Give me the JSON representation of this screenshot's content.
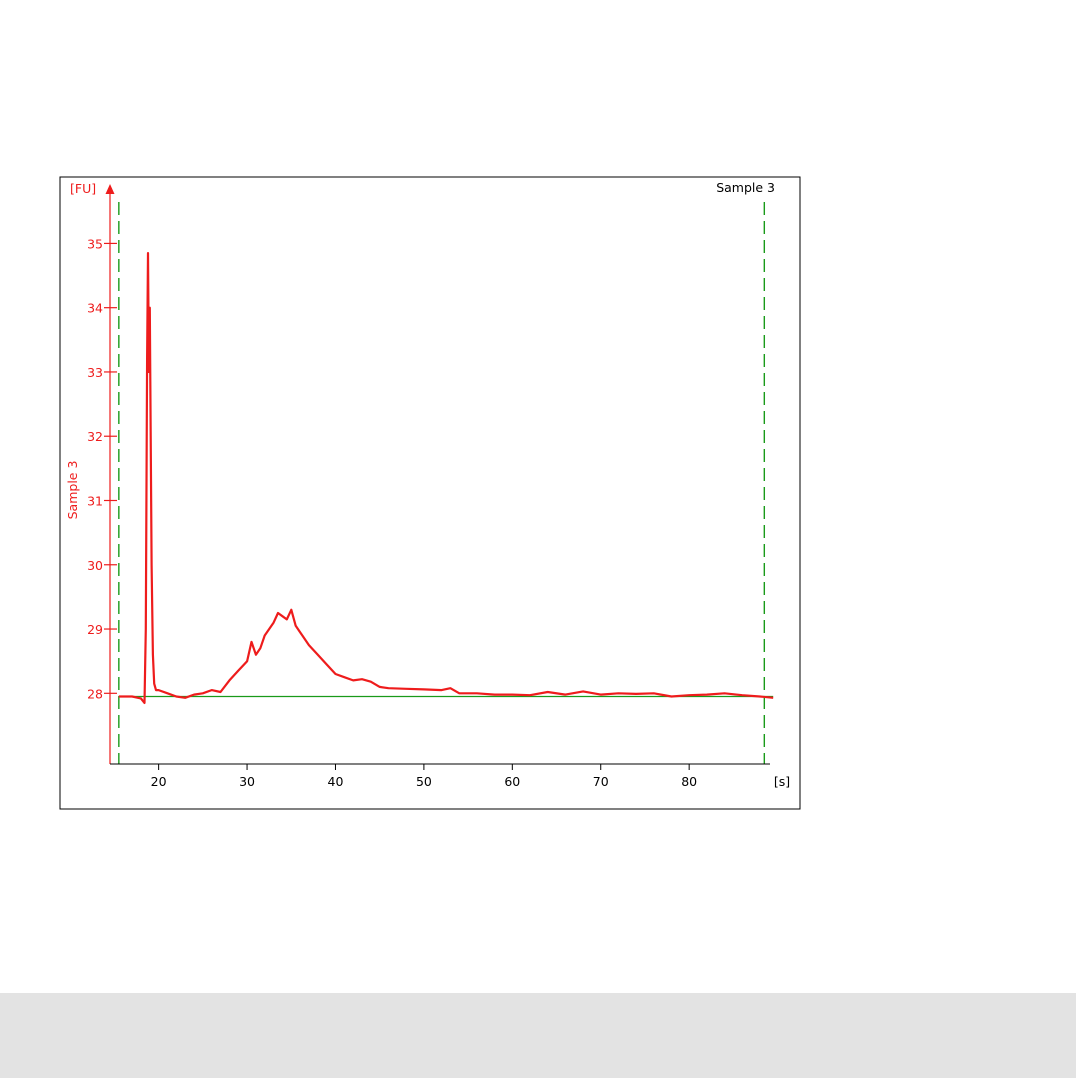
{
  "chart_data": {
    "type": "line",
    "title": "Sample 3",
    "xlabel": "",
    "ylabel": "Sample 3",
    "x_unit": "[s]",
    "y_unit": "[FU]",
    "xlim": [
      14.5,
      90.5
    ],
    "ylim": [
      26.9,
      35.8
    ],
    "x_ticks": [
      20,
      30,
      40,
      50,
      60,
      70,
      80
    ],
    "y_ticks": [
      28,
      29,
      30,
      31,
      32,
      33,
      34,
      35
    ],
    "grid": false,
    "legend": "none",
    "marker_lines": [
      15.5,
      88.5
    ],
    "baseline": 27.95,
    "series": [
      {
        "name": "Sample 3",
        "color": "#ee1c1c",
        "x": [
          15.5,
          17.0,
          18.0,
          18.4,
          18.55,
          18.7,
          18.8,
          18.9,
          19.0,
          19.1,
          19.2,
          19.35,
          19.5,
          19.7,
          20.0,
          21.0,
          22.0,
          23.0,
          24.0,
          25.0,
          26.0,
          27.0,
          28.0,
          29.0,
          30.0,
          30.5,
          31.0,
          31.5,
          32.0,
          32.5,
          33.0,
          33.5,
          34.0,
          34.5,
          35.0,
          35.5,
          36.0,
          37.0,
          38.0,
          39.0,
          40.0,
          41.0,
          42.0,
          43.0,
          44.0,
          45.0,
          46.0,
          48.0,
          50.0,
          52.0,
          53.0,
          54.0,
          56.0,
          58.0,
          60.0,
          62.0,
          64.0,
          66.0,
          68.0,
          70.0,
          72.0,
          74.0,
          76.0,
          78.0,
          80.0,
          82.0,
          84.0,
          86.0,
          88.0,
          89.5
        ],
        "y": [
          27.95,
          27.95,
          27.92,
          27.85,
          29.0,
          33.2,
          34.85,
          33.0,
          34.0,
          32.0,
          30.0,
          28.6,
          28.15,
          28.05,
          28.05,
          28.0,
          27.95,
          27.93,
          27.98,
          28.0,
          28.05,
          28.02,
          28.2,
          28.35,
          28.5,
          28.8,
          28.6,
          28.7,
          28.9,
          29.0,
          29.1,
          29.25,
          29.2,
          29.15,
          29.3,
          29.05,
          28.95,
          28.75,
          28.6,
          28.45,
          28.3,
          28.25,
          28.2,
          28.22,
          28.18,
          28.1,
          28.08,
          28.07,
          28.06,
          28.05,
          28.08,
          28.0,
          28.0,
          27.98,
          27.98,
          27.97,
          28.02,
          27.98,
          28.03,
          27.98,
          28.0,
          27.99,
          28.0,
          27.95,
          27.97,
          27.98,
          28.0,
          27.97,
          27.95,
          27.93
        ]
      }
    ]
  },
  "colors": {
    "axis": "#ee1c1c",
    "trace": "#ee1c1c",
    "baseline": "#1a9a1a",
    "markers": "#1a9a1a",
    "frame": "#000000",
    "footer": "#e3e3e3"
  }
}
